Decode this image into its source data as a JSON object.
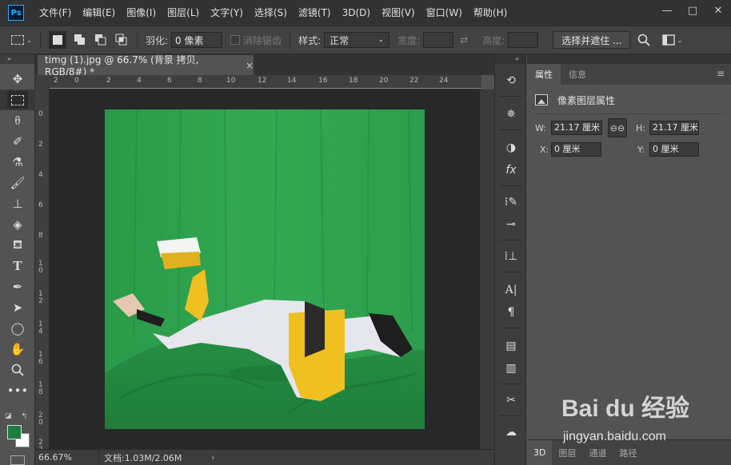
{
  "app": {
    "logo": "Ps"
  },
  "menu": [
    "文件(F)",
    "编辑(E)",
    "图像(I)",
    "图层(L)",
    "文字(Y)",
    "选择(S)",
    "滤镜(T)",
    "3D(D)",
    "视图(V)",
    "窗口(W)",
    "帮助(H)"
  ],
  "window_controls": {
    "minimize": "—",
    "maximize": "□",
    "close": "✕"
  },
  "options": {
    "feather_label": "羽化:",
    "feather_value": "0 像素",
    "antialias_label": "消除锯齿",
    "style_label": "样式:",
    "style_value": "正常",
    "width_label": "宽度:",
    "height_label": "高度:",
    "select_mask_button": "选择并遮住 ..."
  },
  "document": {
    "tab_title": "timg (1).jpg @ 66.7% (背景 拷贝, RGB/8#) *",
    "tab_close": "×",
    "zoom": "66.67%",
    "doc_info": "文档:1.03M/2.06M",
    "status_arrow": "›"
  },
  "rulers": {
    "top": [
      "2",
      "0",
      "2",
      "4",
      "6",
      "8",
      "10",
      "12",
      "14",
      "16",
      "18",
      "20",
      "22",
      "24"
    ],
    "left": [
      "0",
      "2",
      "4",
      "6",
      "8",
      "1 0",
      "1 2",
      "1 4",
      "1 6",
      "1 8",
      "2 0",
      "2 2"
    ]
  },
  "properties_panel": {
    "tabs": [
      "属性",
      "信息"
    ],
    "section_title": "像素图层属性",
    "w_label": "W:",
    "w_value": "21.17 厘米",
    "h_label": "H:",
    "h_value": "21.17 厘米",
    "x_label": "X:",
    "x_value": "0 厘米",
    "y_label": "Y:",
    "y_value": "0 厘米",
    "bottom_tabs": [
      "3D",
      "图层",
      "通道",
      "路径"
    ]
  },
  "watermark": {
    "brand": "Bai du 经验",
    "url": "jingyan.baidu.com"
  },
  "colors": {
    "foreground": "#1f7a3f",
    "background": "#ffffff",
    "canvas_green": "#2fa24e"
  }
}
